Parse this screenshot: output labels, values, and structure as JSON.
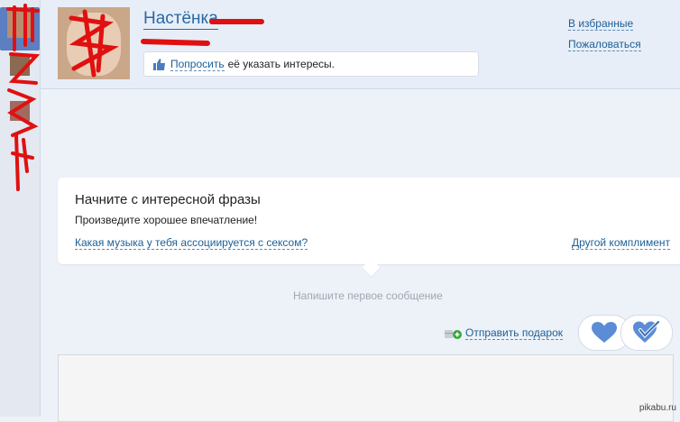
{
  "header": {
    "user_name": "Настёнка",
    "interest_prompt": {
      "ask_link": "Попросить",
      "text": "её указать интересы."
    },
    "favorites_link": "В избранные",
    "report_link": "Пожаловаться"
  },
  "compliment_card": {
    "title": "Начните с интересной фразы",
    "subtitle": "Произведите хорошее впечатление!",
    "question_link": "Какая музыка у тебя ассоциируется с сексом?",
    "other_link": "Другой комплимент"
  },
  "first_message_hint": "Напишите первое сообщение",
  "actions": {
    "gift_link": "Отправить подарок"
  },
  "watermark": "pikabu.ru",
  "icons": {
    "like": "thumbs-up-icon",
    "gift": "gift-add-icon",
    "heart": "heart-icon",
    "check": "heart-check-icon"
  },
  "colors": {
    "link": "#1c5f96",
    "heart_blue": "#5b8dd6",
    "scribble": "#e01010"
  }
}
